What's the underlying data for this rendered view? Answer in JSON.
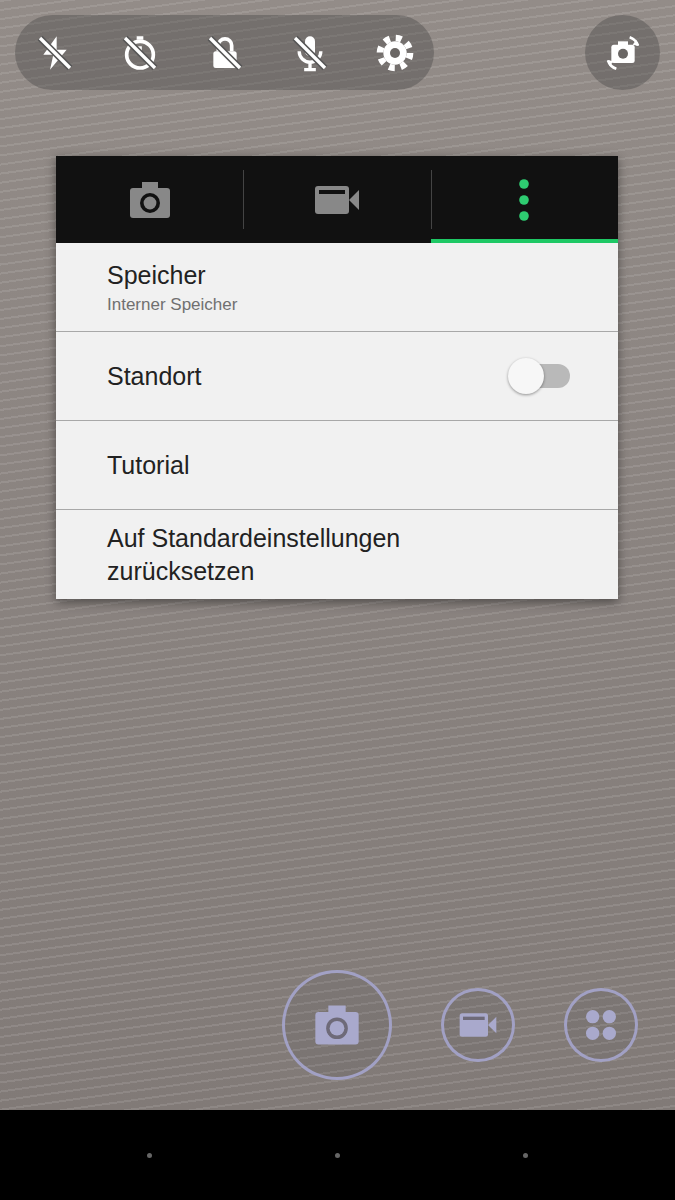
{
  "toggles": [
    {
      "kind": "flash",
      "on": false
    },
    {
      "kind": "timer",
      "on": false
    },
    {
      "kind": "lock",
      "on": false
    },
    {
      "kind": "mic",
      "on": false
    }
  ],
  "popup": {
    "tabs": [
      {
        "kind": "photo",
        "selected": false
      },
      {
        "kind": "video",
        "selected": false
      },
      {
        "kind": "more",
        "selected": true
      }
    ],
    "items": [
      {
        "kind": "select",
        "label": "Speicher",
        "value": "Interner Speicher"
      },
      {
        "kind": "toggle",
        "label": "Standort",
        "on": false
      },
      {
        "kind": "action",
        "label": "Tutorial"
      },
      {
        "kind": "action",
        "label": "Auf Standardeinstellungen zurücksetzen"
      }
    ]
  },
  "controls": [
    {
      "kind": "photo"
    },
    {
      "kind": "video"
    },
    {
      "kind": "more"
    }
  ]
}
